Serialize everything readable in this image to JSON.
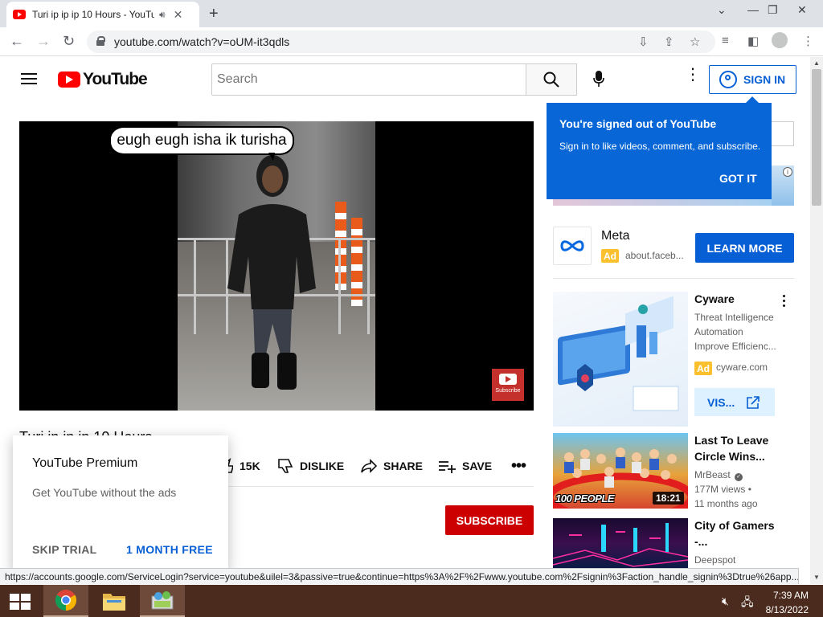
{
  "browser": {
    "tab_title": "Turi ip ip ip 10 Hours - YouTube",
    "url": "youtube.com/watch?v=oUM-it3qdls",
    "status_url": "https://accounts.google.com/ServiceLogin?service=youtube&uilel=3&passive=true&continue=https%3A%2F%2Fwww.youtube.com%2Fsignin%3Faction_handle_signin%3Dtrue%26app..."
  },
  "header": {
    "logo_text": "YouTube",
    "search_placeholder": "Search",
    "signin_label": "SIGN IN"
  },
  "video": {
    "caption": "eugh eugh isha ik turisha",
    "watermark_label": "Subscribe",
    "title": "Turi ip ip ip 10 Hours",
    "likes": "15K",
    "dislike_label": "DISLIKE",
    "share_label": "SHARE",
    "save_label": "SAVE",
    "subscribe_label": "SUBSCRIBE"
  },
  "premium_popup": {
    "title": "YouTube Premium",
    "description": "Get YouTube without the ads",
    "skip_label": "SKIP TRIAL",
    "free_label": "1 MONTH FREE"
  },
  "signin_tooltip": {
    "title": "You're signed out of YouTube",
    "body": "Sign in to like videos, comment, and subscribe.",
    "dismiss_label": "GOT IT"
  },
  "meta_ad": {
    "name": "Meta",
    "badge": "Ad",
    "url": "about.faceb...",
    "cta": "LEARN MORE"
  },
  "cyware_ad": {
    "title": "Cyware",
    "desc_line1": "Threat Intelligence",
    "desc_line2": "Automation",
    "desc_line3": "Improve Efficienc...",
    "badge": "Ad",
    "domain": "cyware.com",
    "cta": "VIS..."
  },
  "related": [
    {
      "title_line1": "Last To Leave",
      "title_line2": "Circle Wins...",
      "channel": "MrBeast",
      "views": "177M views",
      "age": "11 months ago",
      "duration": "18:21",
      "thumb_text": "100 PEOPLE"
    },
    {
      "title_line1": "City of Gamers",
      "title_line2": "-...",
      "channel": "Deepspot"
    }
  ],
  "taskbar": {
    "time": "7:39 AM",
    "date": "8/13/2022"
  },
  "colors": {
    "youtube_red": "#ff0000",
    "link_blue": "#065fd4",
    "tooltip_blue": "#0866d6",
    "ad_yellow": "#fbc02d",
    "subscribe_red": "#cc0000"
  }
}
